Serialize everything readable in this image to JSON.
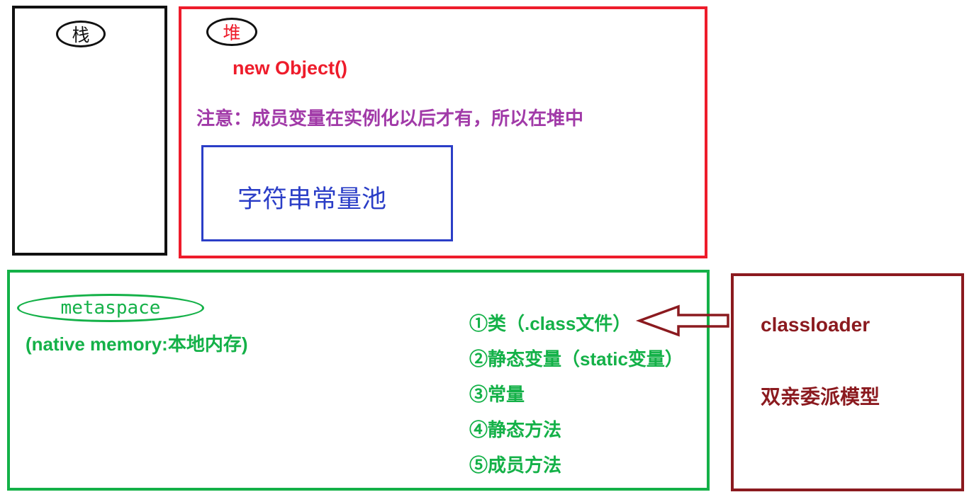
{
  "stack": {
    "label": "栈"
  },
  "heap": {
    "label": "堆",
    "new_object": "new Object()",
    "note": "注意：成员变量在实例化以后才有，所以在堆中",
    "string_pool": "字符串常量池"
  },
  "metaspace": {
    "label": "metaspace",
    "subtitle": "(native memory:本地内存)",
    "items": [
      "①类（.class文件）",
      "②静态变量（static变量）",
      "③常量",
      "④静态方法",
      "⑤成员方法"
    ]
  },
  "classloader": {
    "title": "classloader",
    "model": "双亲委派模型"
  },
  "colors": {
    "stack": "#111111",
    "heap": "#ee1c2b",
    "note": "#a13aa8",
    "string_pool": "#2b3ec7",
    "metaspace": "#14b148",
    "classloader": "#8b1a1f"
  }
}
